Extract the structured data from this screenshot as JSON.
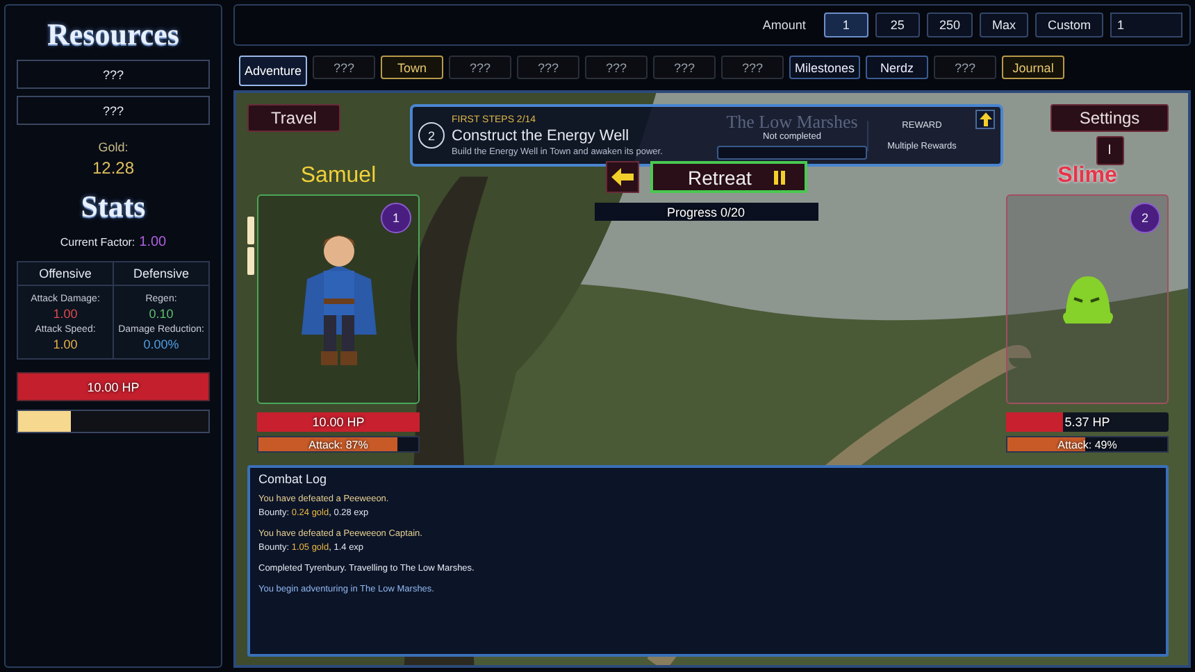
{
  "sidebar": {
    "title": "Resources",
    "resources": [
      "???",
      "???"
    ],
    "gold_label": "Gold:",
    "gold_value": "12.28",
    "stats_title": "Stats",
    "factor_label": "Current Factor:",
    "factor_value": "1.00",
    "stat_columns": [
      {
        "heading": "Offensive",
        "stats": [
          {
            "label": "Attack Damage:",
            "value": "1.00",
            "color": "#e0484e"
          },
          {
            "label": "Attack Speed:",
            "value": "1.00",
            "color": "#e8b04a"
          }
        ]
      },
      {
        "heading": "Defensive",
        "stats": [
          {
            "label": "Regen:",
            "value": "0.10",
            "color": "#5fbf6a"
          },
          {
            "label": "Damage Reduction:",
            "value": "0.00%",
            "color": "#4f9fe0"
          }
        ]
      }
    ],
    "hp": {
      "text": "10.00 HP",
      "level": 1
    },
    "xp": {
      "level": 0.28
    }
  },
  "amount_bar": {
    "label": "Amount",
    "options": [
      {
        "label": "1",
        "selected": true
      },
      {
        "label": "25",
        "selected": false
      },
      {
        "label": "250",
        "selected": false
      },
      {
        "label": "Max",
        "selected": false
      },
      {
        "label": "Custom",
        "selected": false
      }
    ],
    "custom_value": "1"
  },
  "tabs": [
    {
      "label": "Adventure",
      "kind": "unlocked",
      "selected": true
    },
    {
      "label": "???",
      "kind": "locked",
      "selected": false
    },
    {
      "label": "Town",
      "kind": "highlight",
      "selected": false
    },
    {
      "label": "???",
      "kind": "locked",
      "selected": false
    },
    {
      "label": "???",
      "kind": "locked",
      "selected": false
    },
    {
      "label": "???",
      "kind": "locked",
      "selected": false
    },
    {
      "label": "???",
      "kind": "locked",
      "selected": false
    },
    {
      "label": "???",
      "kind": "locked",
      "selected": false
    },
    {
      "label": "Milestones",
      "kind": "unlocked",
      "selected": false
    },
    {
      "label": "Nerdz",
      "kind": "unlocked",
      "selected": false
    },
    {
      "label": "???",
      "kind": "locked",
      "selected": false
    },
    {
      "label": "Journal",
      "kind": "highlight",
      "selected": false
    }
  ],
  "adventure": {
    "location": "The Low Marshes",
    "travel_button": "Travel",
    "settings_button": "Settings",
    "info_button": "I",
    "quest": {
      "chapter": "FIRST STEPS 2/14",
      "number": "2",
      "title": "Construct the Energy Well",
      "description": "Build the Energy Well in Town and awaken its power.",
      "status": "Not completed",
      "level": 0,
      "reward_label": "REWARD",
      "reward": "Multiple Rewards"
    },
    "retreat_button": "Retreat",
    "progress": {
      "text": "Progress 0/20",
      "level": 0
    },
    "hero": {
      "name": "Samuel",
      "level_badge": "1",
      "hp": {
        "text": "10.00 HP",
        "level": 1
      },
      "attack": {
        "text": "Attack: 87%",
        "level": 0.87
      }
    },
    "enemy": {
      "name": "Slime",
      "level_badge": "2",
      "hp": {
        "text": "5.37 HP",
        "level": 0.35
      },
      "attack": {
        "text": "Attack: 49%",
        "level": 0.49
      }
    },
    "combat_log": {
      "title": "Combat Log",
      "groups": [
        [
          {
            "kind": "defeat",
            "text": "You have defeated a Peeweeon."
          },
          {
            "kind": "bounty",
            "label": "Bounty:",
            "gold": "0.24 gold",
            "exp": ", 0.28 exp"
          }
        ],
        [
          {
            "kind": "defeat",
            "text": "You have defeated a Peeweeon Captain."
          },
          {
            "kind": "bounty",
            "label": "Bounty:",
            "gold": "1.05 gold",
            "exp": ", 1.4 exp"
          }
        ],
        [
          {
            "kind": "info",
            "text": "Completed Tyrenbury. Travelling to The Low Marshes."
          }
        ],
        [
          {
            "kind": "begin",
            "text": "You begin adventuring in The Low Marshes."
          }
        ]
      ]
    }
  }
}
